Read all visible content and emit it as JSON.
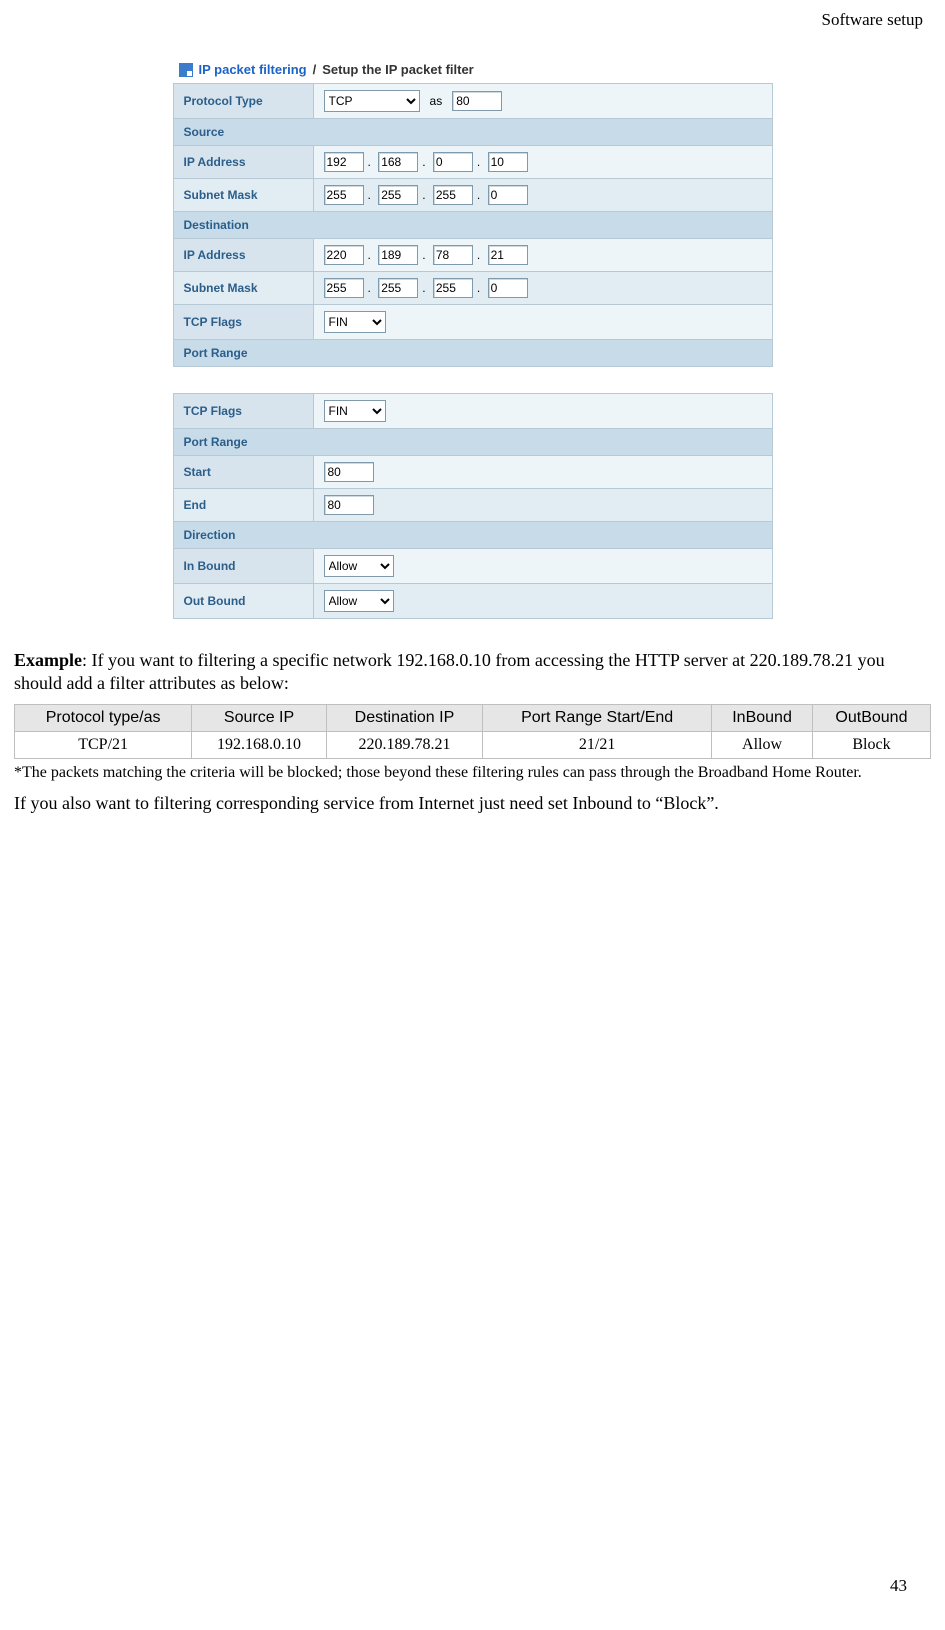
{
  "header": {
    "section": "Software  setup"
  },
  "panel": {
    "breadcrumb_link": "IP packet filtering",
    "breadcrumb_sep": " / ",
    "breadcrumb_title": "Setup the IP packet filter"
  },
  "form1": {
    "protocol_type_label": "Protocol Type",
    "protocol_type_value": "TCP",
    "as_label": "as",
    "as_value": "80",
    "source_label": "Source",
    "ip_label": "IP Address",
    "subnet_label": "Subnet Mask",
    "src_ip": [
      "192",
      "168",
      "0",
      "10"
    ],
    "src_mask": [
      "255",
      "255",
      "255",
      "0"
    ],
    "dest_label": "Destination",
    "dst_ip": [
      "220",
      "189",
      "78",
      "21"
    ],
    "dst_mask": [
      "255",
      "255",
      "255",
      "0"
    ],
    "tcp_flags_label": "TCP Flags",
    "tcp_flags_value": "FIN",
    "port_range_label": "Port Range"
  },
  "form2": {
    "tcp_flags_label": "TCP Flags",
    "tcp_flags_value": "FIN",
    "port_range_label": "Port Range",
    "start_label": "Start",
    "start_value": "80",
    "end_label": "End",
    "end_value": "80",
    "direction_label": "Direction",
    "inbound_label": "In Bound",
    "inbound_value": "Allow",
    "outbound_label": "Out Bound",
    "outbound_value": "Allow"
  },
  "example": {
    "prefix": "Example",
    "text": ": If you want to filtering a specific network 192.168.0.10 from accessing the HTTP server at 220.189.78.21 you should add a filter attributes as below:"
  },
  "rules_table": {
    "headers": [
      "Protocol type/as",
      "Source IP",
      "Destination IP",
      "Port Range Start/End",
      "InBound",
      "OutBound"
    ],
    "row": [
      "TCP/21",
      "192.168.0.10",
      "220.189.78.21",
      "21/21",
      "Allow",
      "Block"
    ]
  },
  "footnote": "*The packets matching the criteria will be blocked; those beyond these filtering rules can pass through the Broadband Home Router.",
  "closing": "If you also want to filtering corresponding service from Internet just need set Inbound to “Block”.",
  "page_number": "43"
}
